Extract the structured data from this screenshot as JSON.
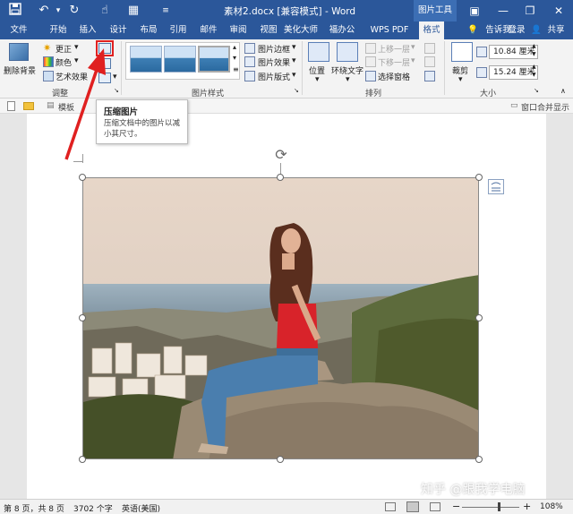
{
  "title_bar": {
    "document_title": "素材2.docx [兼容模式] - Word",
    "context_title": "图片工具",
    "save_icon": "save-icon",
    "undo_icon": "undo-icon",
    "redo_icon": "redo-icon"
  },
  "tabs": [
    "文件",
    "开始",
    "插入",
    "设计",
    "布局",
    "引用",
    "邮件",
    "审阅",
    "视图",
    "美化大师",
    "福办公",
    "WPS PDF",
    "格式"
  ],
  "tell_me": "告诉我...",
  "login": "登录",
  "share": "共享",
  "ribbon": {
    "remove_bg": "删除背景",
    "corrections": "更正",
    "color": "颜色",
    "artistic": "艺术效果",
    "adjust_group": "调整",
    "picture_border": "图片边框",
    "picture_effects": "图片效果",
    "picture_layout": "图片版式",
    "styles_group": "图片样式",
    "position": "位置",
    "wrap_text": "环绕文字",
    "bring_forward": "上移一层",
    "send_backward": "下移一层",
    "selection_pane": "选择窗格",
    "arrange_group": "排列",
    "crop": "裁剪",
    "height": "10.84 厘米",
    "width": "15.24 厘米",
    "size_group": "大小"
  },
  "nav": {
    "tab_label": "模板",
    "window_merge": "窗口合并显示"
  },
  "tooltip": {
    "title": "压缩图片",
    "body": "压缩文档中的图片以减小其尺寸。"
  },
  "status": {
    "page": "第 8 页，共 8 页",
    "words": "3702 个字",
    "lang": "英语(美国)",
    "zoom": "108%",
    "zoom_fraction": 0.62
  },
  "watermark": "知乎 @跟我学电脑",
  "colors": {
    "brand": "#2b579a",
    "annotation": "#e02020"
  }
}
